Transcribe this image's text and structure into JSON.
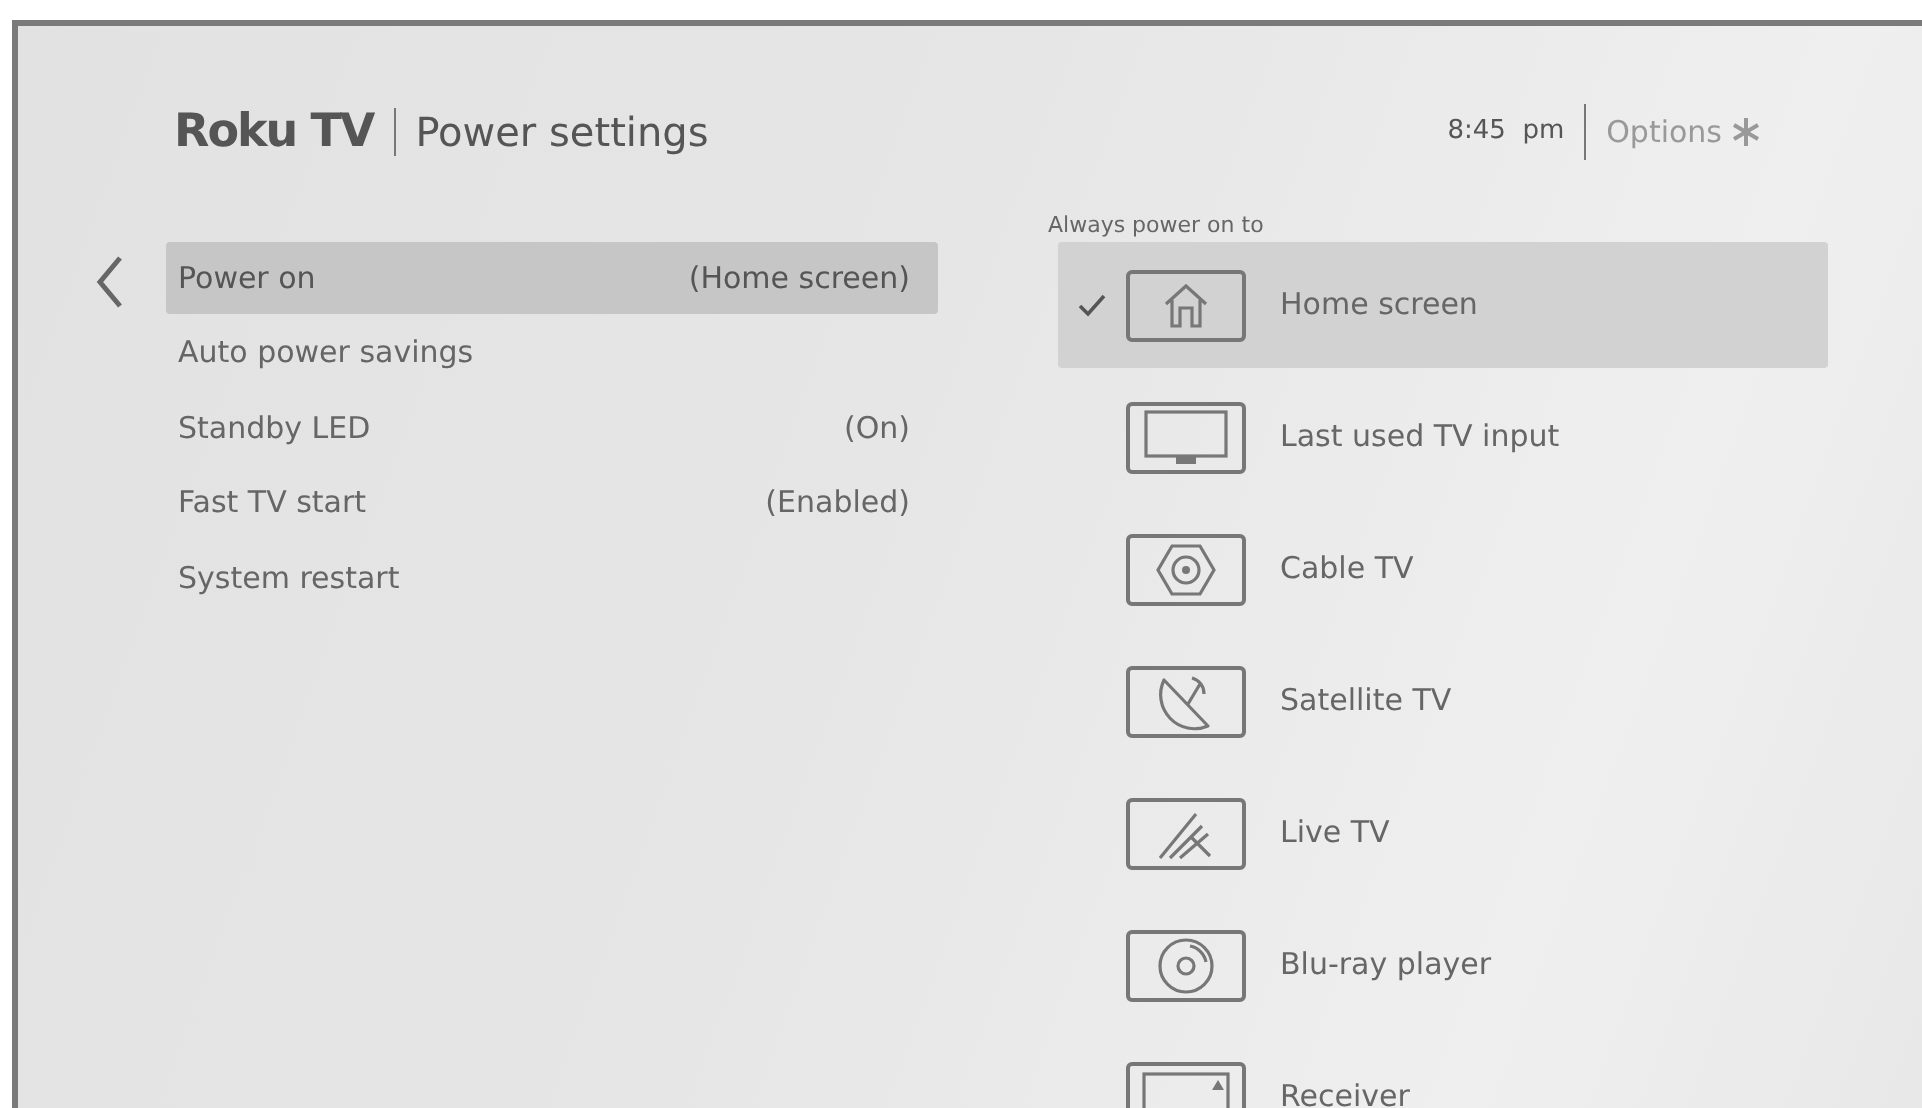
{
  "header": {
    "logo": "Roku TV",
    "title": "Power settings",
    "time": "8:45  pm",
    "options": "Options"
  },
  "menu": [
    {
      "label": "Power on",
      "value": "(Home screen)",
      "selected": true
    },
    {
      "label": "Auto power savings",
      "selected": false
    },
    {
      "label": "Standby LED",
      "value": "(On)",
      "selected": false
    },
    {
      "label": "Fast TV start",
      "value": "(Enabled)",
      "selected": false
    },
    {
      "label": "System restart",
      "selected": false
    }
  ],
  "options_panel": {
    "heading": "Always power on to",
    "items": [
      {
        "kind": "home",
        "label": "Home screen",
        "selected": true
      },
      {
        "kind": "tv",
        "label": "Last used TV input",
        "selected": false
      },
      {
        "kind": "cable",
        "label": "Cable TV",
        "selected": false
      },
      {
        "kind": "satellite",
        "label": "Satellite TV",
        "selected": false
      },
      {
        "kind": "antenna",
        "label": "Live TV",
        "selected": false
      },
      {
        "kind": "disc",
        "label": "Blu-ray player",
        "selected": false
      },
      {
        "kind": "receiver",
        "label": "Receiver",
        "selected": false
      }
    ]
  }
}
